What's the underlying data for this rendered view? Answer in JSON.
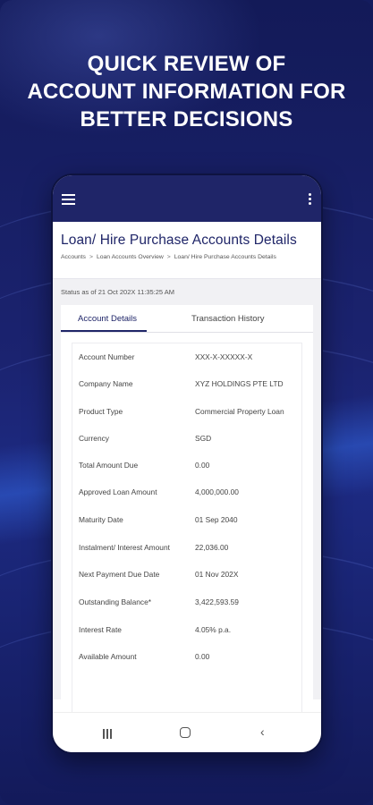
{
  "headline": {
    "line1": "QUICK REVIEW OF",
    "line2": "ACCOUNT INFORMATION FOR",
    "line3": "BETTER DECISIONS"
  },
  "app": {
    "menu_icon": "hamburger-icon",
    "overflow_icon": "more-vertical-icon",
    "title": "Loan/ Hire Purchase Accounts Details",
    "breadcrumb": [
      "Accounts",
      "Loan Accounts Overview",
      "Loan/ Hire Purchase Accounts Details"
    ],
    "breadcrumb_separator": ">",
    "status": "Status as of 21 Oct 202X 11:35:25 AM",
    "tabs": [
      {
        "label": "Account Details",
        "active": true
      },
      {
        "label": "Transaction History",
        "active": false
      }
    ],
    "details": [
      {
        "label": "Account Number",
        "value": "XXX-X-XXXXX-X"
      },
      {
        "label": "Company Name",
        "value": "XYZ HOLDINGS PTE LTD"
      },
      {
        "label": "Product Type",
        "value": "Commercial Property Loan"
      },
      {
        "label": "Currency",
        "value": "SGD"
      },
      {
        "label": "Total Amount Due",
        "value": "0.00"
      },
      {
        "label": "Approved Loan Amount",
        "value": "4,000,000.00"
      },
      {
        "label": "Maturity Date",
        "value": "01 Sep 2040"
      },
      {
        "label": "Instalment/ Interest Amount",
        "value": "22,036.00"
      },
      {
        "label": "Next Payment Due Date",
        "value": "01 Nov 202X"
      },
      {
        "label": "Outstanding Balance*",
        "value": "3,422,593.59"
      },
      {
        "label": "Interest Rate",
        "value": "4.05% p.a."
      },
      {
        "label": "Available Amount",
        "value": "0.00"
      }
    ]
  },
  "android_nav": {
    "recent_icon": "recent-apps-icon",
    "home_icon": "home-icon",
    "back_icon": "back-icon"
  },
  "colors": {
    "background": "#141c5e",
    "app_bar": "#1f2568",
    "accent": "#1f2568"
  }
}
